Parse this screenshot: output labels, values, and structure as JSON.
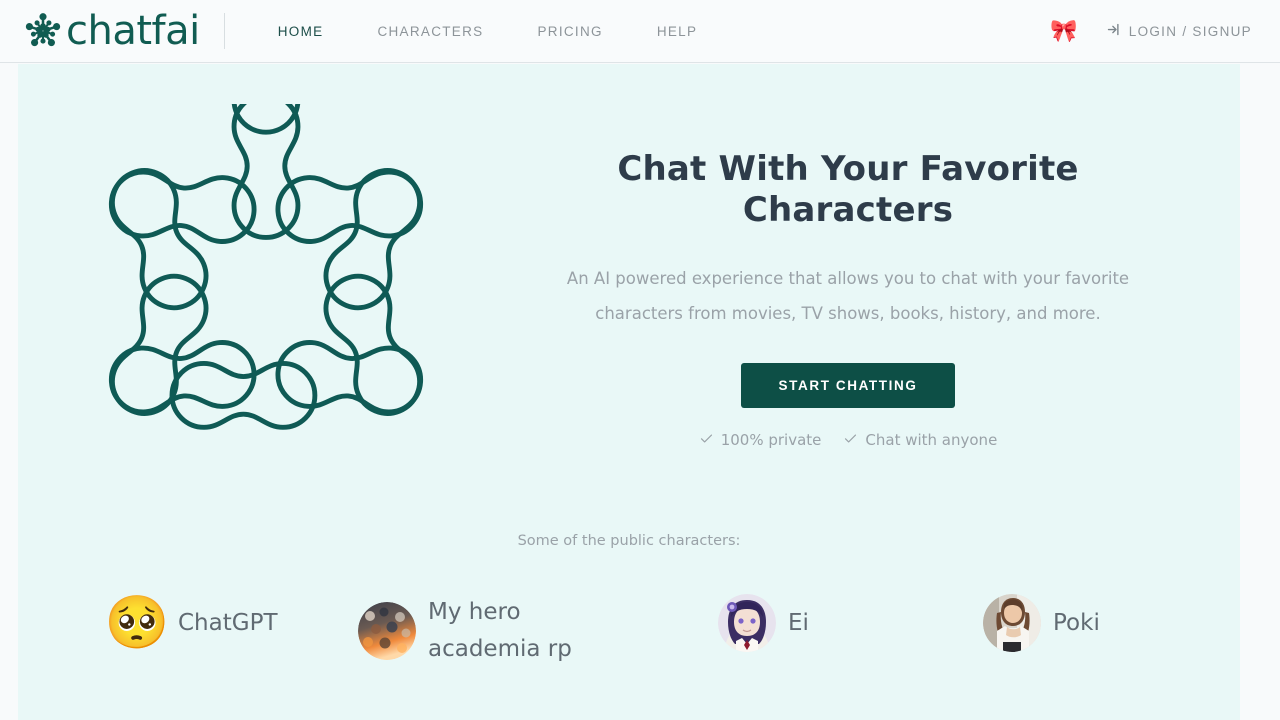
{
  "header": {
    "brand": {
      "word": "chatfai",
      "mark_icon": "chatfai-logo-icon"
    },
    "nav": [
      {
        "label": "HOME",
        "active": true
      },
      {
        "label": "CHARACTERS",
        "active": false
      },
      {
        "label": "PRICING",
        "active": false
      },
      {
        "label": "HELP",
        "active": false
      }
    ],
    "bow_icon": "🎀",
    "login": {
      "label": "LOGIN / SIGNUP",
      "icon": "login-arrow-icon"
    }
  },
  "hero": {
    "art_icon": "radial-dumbbell-pattern-icon",
    "title": "Chat With Your Favorite Characters",
    "subtitle": "An AI powered experience that allows you to chat with your favorite characters from movies, TV shows, books, history, and more.",
    "cta_label": "START CHATTING",
    "features": [
      {
        "label": "100% private",
        "icon": "check-icon"
      },
      {
        "label": "Chat with anyone",
        "icon": "check-icon"
      }
    ]
  },
  "characters_section": {
    "label": "Some of the public characters:",
    "items": [
      {
        "name": "ChatGPT",
        "avatar_type": "emoji",
        "avatar": "🥺"
      },
      {
        "name": "My hero academia rp",
        "avatar_type": "photo",
        "avatar": "anime-group-photo-avatar"
      },
      {
        "name": "Ei",
        "avatar_type": "photo",
        "avatar": "purple-hair-anime-girl-avatar"
      },
      {
        "name": "Poki",
        "avatar_type": "photo",
        "avatar": "woman-photo-avatar"
      }
    ]
  },
  "colors": {
    "brand_teal": "#115c52",
    "cta_background": "#0d4f46",
    "hero_background": "#e9f8f7",
    "page_background": "#f8fafb",
    "heading": "#2e3c4a",
    "muted_text": "#9aa2a8",
    "bow_pink": "#ef4f91"
  }
}
